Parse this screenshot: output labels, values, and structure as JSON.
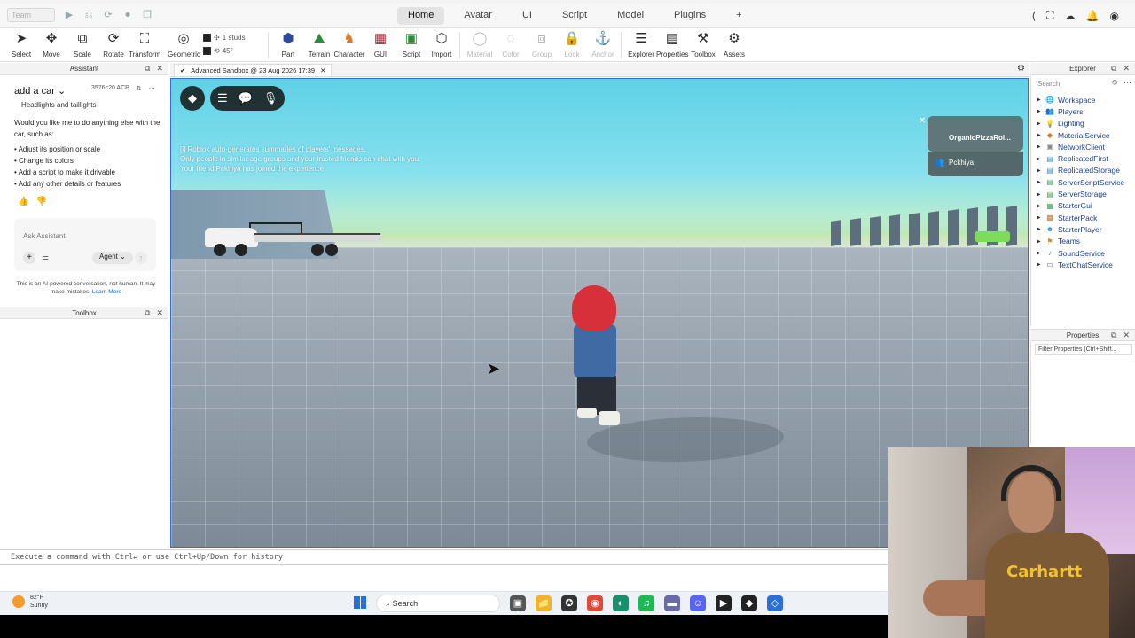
{
  "topbar": {
    "team_label": "Team",
    "tabs": [
      "Home",
      "Avatar",
      "UI",
      "Script",
      "Model",
      "Plugins"
    ],
    "active_tab": "Home",
    "add_tab": "+"
  },
  "ribbon": {
    "select": "Select",
    "move": "Move",
    "scale": "Scale",
    "rotate": "Rotate",
    "transform": "Transform",
    "geometric": "Geometric",
    "stud_snap": "1 studs",
    "rot_snap": "45°",
    "part": "Part",
    "terrain": "Terrain",
    "character": "Character",
    "gui": "GUI",
    "script": "Script",
    "import": "Import",
    "material": "Material",
    "color": "Color",
    "group": "Group",
    "lock": "Lock",
    "anchor": "Anchor",
    "explorer": "Explorer",
    "properties": "Properties",
    "toolbox": "Toolbox",
    "assets": "Assets"
  },
  "assistant": {
    "panel_title": "Assistant",
    "conversation_title": "add a car",
    "conversation_meta": "3576c20 ACP",
    "cut_line": "Headlights and taillights",
    "question": "Would you like me to do anything else with the car, such as:",
    "options": [
      "Adjust its position or scale",
      "Change its colors",
      "Add a script to make it drivable",
      "Add any other details or features"
    ],
    "ask_placeholder": "Ask Assistant",
    "mode": "Agent",
    "disclaimer": "This is an AI-powered conversation, not human. It may make mistakes.",
    "learn_more": "Learn More"
  },
  "toolbox": {
    "panel_title": "Toolbox"
  },
  "viewport": {
    "tab_title": "Advanced Sandbox @ 23 Aug 2026 17:39",
    "chat_lines": [
      "[i] Roblox auto-generates summaries of players' messages.",
      "Only people in similar age groups and your trusted friends can chat with you.",
      "Your friend Pckhiya has joined the experience."
    ],
    "player_list_title": "OrganicPizzaRol...",
    "player_name": "Pckhiya"
  },
  "command_bar": {
    "placeholder": "Execute a command with Ctrl↵ or use Ctrl+Up/Down for history"
  },
  "explorer": {
    "panel_title": "Explorer",
    "search_placeholder": "Search",
    "items": [
      {
        "label": "Workspace",
        "icon": "🌐",
        "color": "#3d7bd9"
      },
      {
        "label": "Players",
        "icon": "👥",
        "color": "#d08b2a"
      },
      {
        "label": "Lighting",
        "icon": "💡",
        "color": "#e3b22a"
      },
      {
        "label": "MaterialService",
        "icon": "◆",
        "color": "#c9782b"
      },
      {
        "label": "NetworkClient",
        "icon": "▣",
        "color": "#888"
      },
      {
        "label": "ReplicatedFirst",
        "icon": "▤",
        "color": "#3b8fd9"
      },
      {
        "label": "ReplicatedStorage",
        "icon": "▤",
        "color": "#3b8fd9"
      },
      {
        "label": "ServerScriptService",
        "icon": "▤",
        "color": "#3aa655"
      },
      {
        "label": "ServerStorage",
        "icon": "▤",
        "color": "#3aa655"
      },
      {
        "label": "StarterGui",
        "icon": "▦",
        "color": "#3aa655"
      },
      {
        "label": "StarterPack",
        "icon": "▩",
        "color": "#c9782b"
      },
      {
        "label": "StarterPlayer",
        "icon": "☻",
        "color": "#3b8fd9"
      },
      {
        "label": "Teams",
        "icon": "⚑",
        "color": "#d08b2a"
      },
      {
        "label": "SoundService",
        "icon": "♪",
        "color": "#3b8fd9"
      },
      {
        "label": "TextChatService",
        "icon": "▭",
        "color": "#555"
      }
    ]
  },
  "properties": {
    "panel_title": "Properties",
    "filter_placeholder": "Filter Properties (Ctrl+Shift..."
  },
  "taskbar": {
    "temp": "82°F",
    "condition": "Sunny",
    "search": "Search"
  },
  "webcam": {
    "shirt_logo": "Carhartt"
  }
}
